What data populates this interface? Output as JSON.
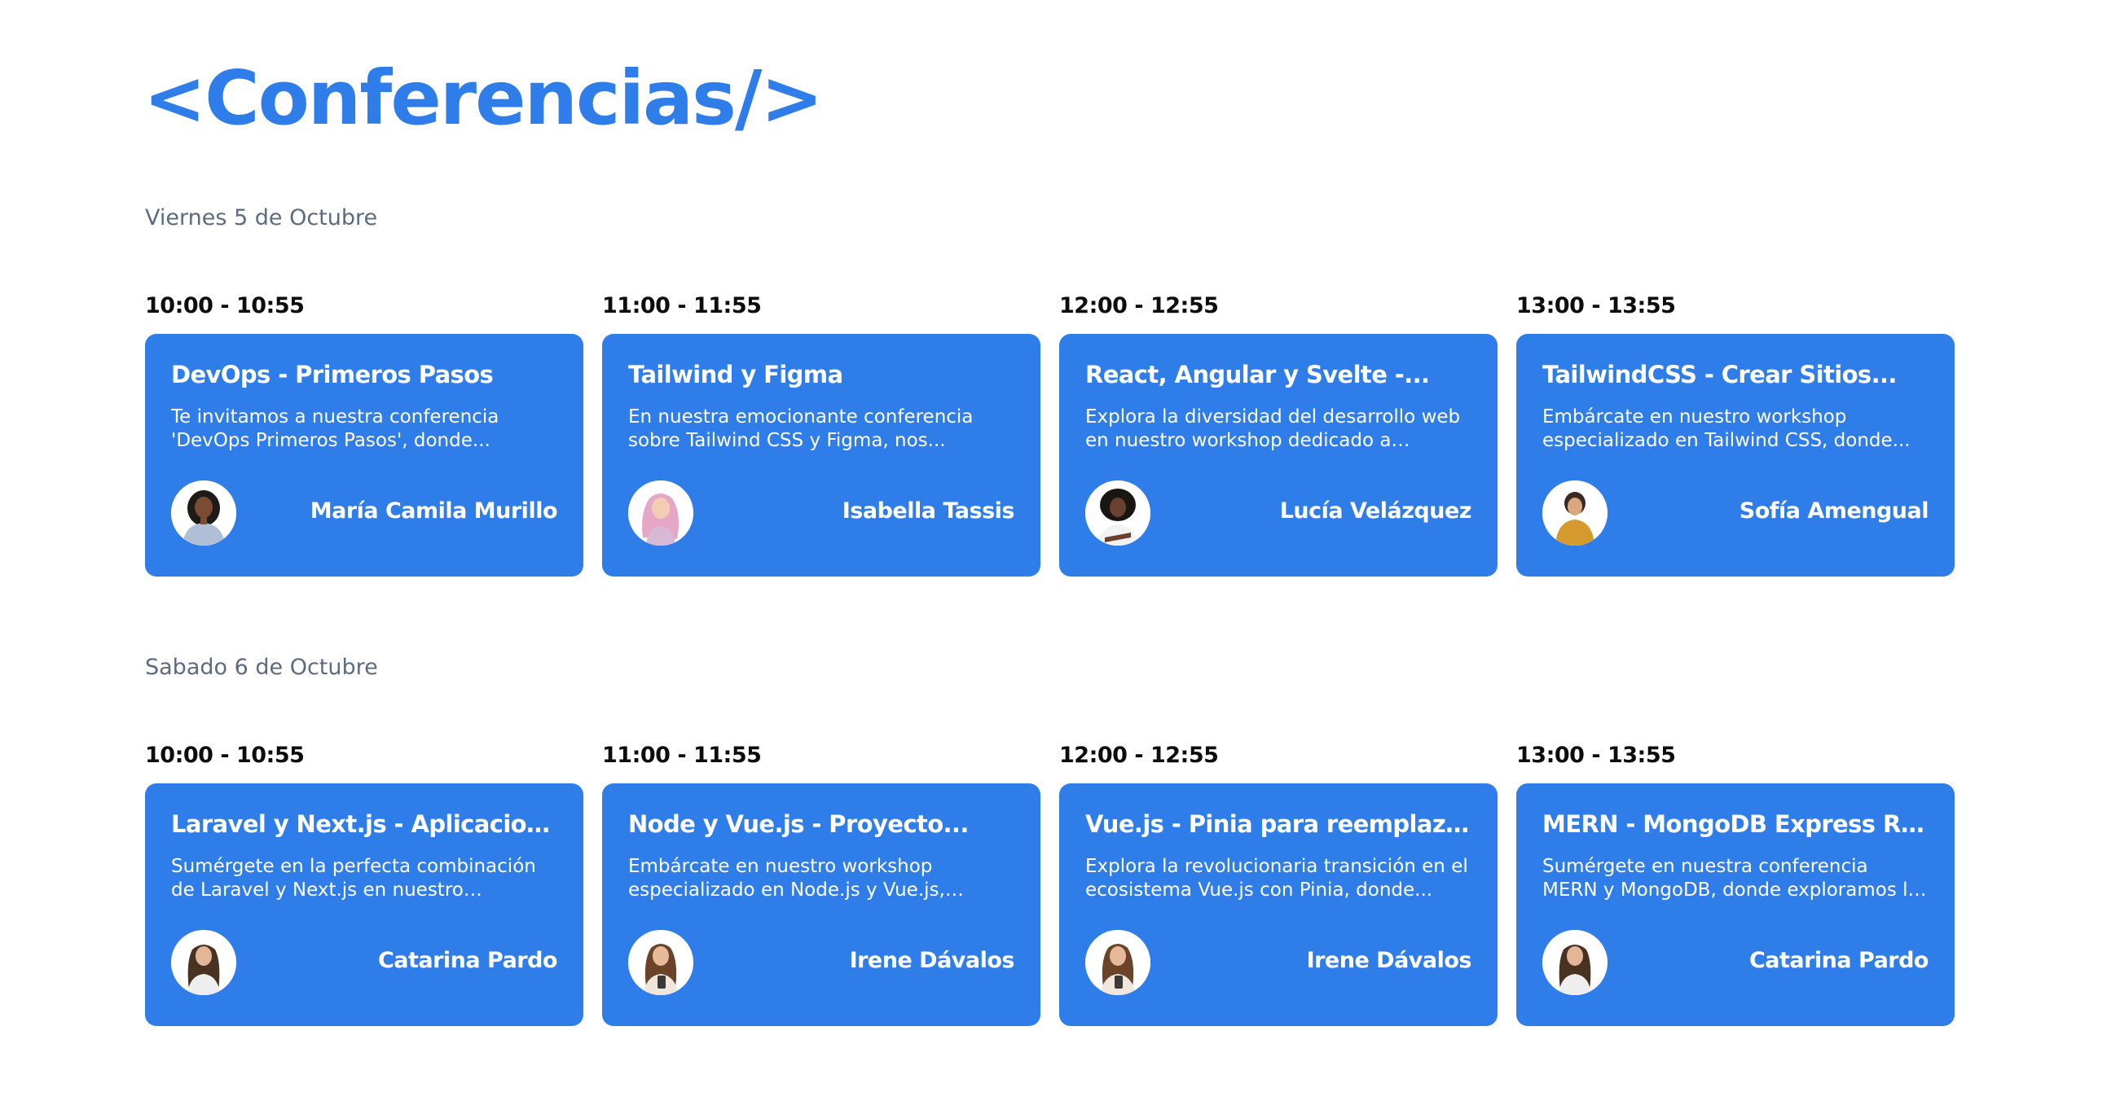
{
  "page": {
    "title": "<Conferencias/>"
  },
  "colors": {
    "accent": "#2f7de8",
    "card_text": "#ffffff",
    "day_label": "#5d6b80",
    "time_text": "#0d0d0d"
  },
  "days": [
    {
      "label": "Viernes 5 de Octubre",
      "sessions": [
        {
          "time": "10:00 - 10:55",
          "title": "DevOps - Primeros Pasos",
          "description": "Te invitamos a nuestra conferencia 'DevOps Primeros Pasos', donde...",
          "speaker": "María Camila Murillo"
        },
        {
          "time": "11:00 - 11:55",
          "title": "Tailwind y Figma",
          "description": "En nuestra emocionante conferencia sobre Tailwind CSS y Figma, nos...",
          "speaker": "Isabella Tassis"
        },
        {
          "time": "12:00 - 12:55",
          "title": "React, Angular y Svelte -...",
          "description": "Explora la diversidad del desarrollo web en nuestro workshop dedicado a Angula...",
          "speaker": "Lucía Velázquez"
        },
        {
          "time": "13:00 - 13:55",
          "title": "TailwindCSS - Crear Sitios...",
          "description": "Embárcate en nuestro workshop especializado en Tailwind CSS, donde...",
          "speaker": "Sofía Amengual"
        }
      ]
    },
    {
      "label": "Sabado 6 de Octubre",
      "sessions": [
        {
          "time": "10:00 - 10:55",
          "title": "Laravel y Next.js - Aplicacione...",
          "description": "Sumérgete en la perfecta combinación de Laravel y Next.js en nuestro workshop...",
          "speaker": "Catarina Pardo"
        },
        {
          "time": "11:00 - 11:55",
          "title": "Node y Vue.js - Proyecto...",
          "description": "Embárcate en nuestro workshop especializado en Node.js y Vue.js, donde...",
          "speaker": "Irene Dávalos"
        },
        {
          "time": "12:00 - 12:55",
          "title": "Vue.js - Pinia para reemplazar...",
          "description": "Explora la revolucionaria transición en el ecosistema Vue.js con Pinia, donde...",
          "speaker": "Irene Dávalos"
        },
        {
          "time": "13:00 - 13:55",
          "title": "MERN - MongoDB Express Rea...",
          "description": "Sumérgete en nuestra conferencia MERN y MongoDB, donde exploramos la sinerg...",
          "speaker": "Catarina Pardo"
        }
      ]
    }
  ],
  "icons": {
    "prev": "chevron-left-icon",
    "next": "chevron-right-icon",
    "avatar": "speaker-avatar"
  }
}
